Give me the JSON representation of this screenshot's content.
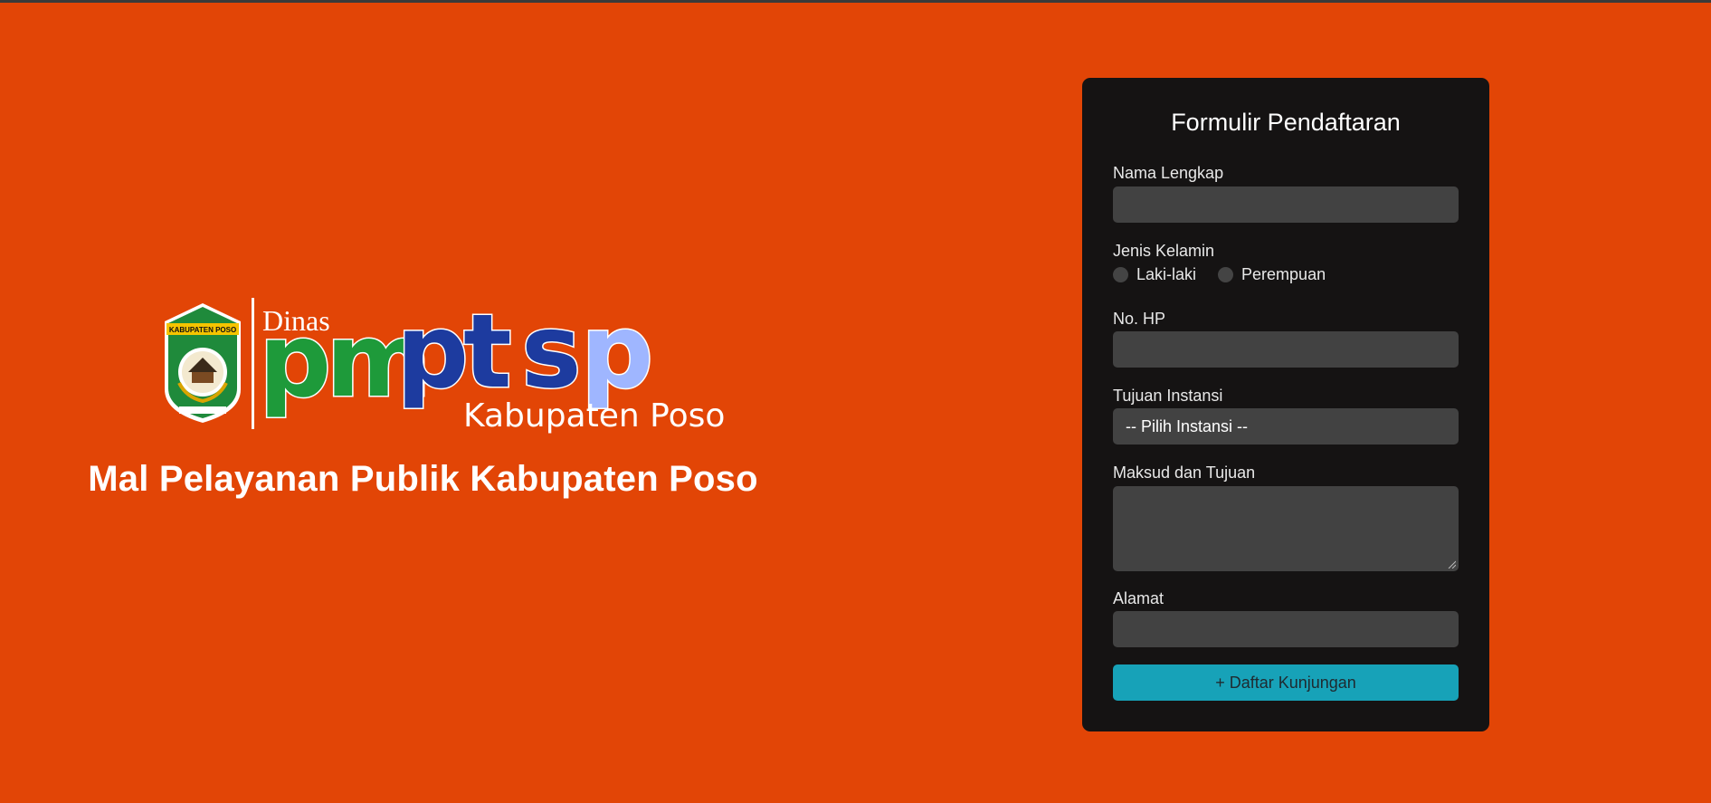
{
  "branding": {
    "logo_dinas": "Dinas",
    "logo_pm": "pm",
    "logo_ptsp_pt": "pt",
    "logo_ptsp_s": "s",
    "logo_ptsp_p": "p",
    "logo_region": "Kabupaten Poso",
    "emblem_banner": "KABUPATEN POSO",
    "hero_title": "Mal Pelayanan Publik Kabupaten Poso"
  },
  "form": {
    "title": "Formulir Pendaftaran",
    "name_label": "Nama Lengkap",
    "name_value": "",
    "gender_label": "Jenis Kelamin",
    "gender_options": [
      "Laki-laki",
      "Perempuan"
    ],
    "phone_label": "No. HP",
    "phone_value": "",
    "agency_label": "Tujuan Instansi",
    "agency_selected": "-- Pilih Instansi --",
    "purpose_label": "Maksud dan Tujuan",
    "purpose_value": "",
    "address_label": "Alamat",
    "address_value": "",
    "submit_label": "+ Daftar Kunjungan"
  },
  "colors": {
    "page_background": "#e24506",
    "card_background": "#151313",
    "field_background": "#424242",
    "button": "#17a2b8",
    "logo_green": "#1e9a3a",
    "logo_blue": "#1d3b9f",
    "logo_light_blue": "#9fb6ff"
  },
  "icons": {
    "emblem": "kabupaten-poso-emblem-icon",
    "resize": "resize-grip-icon"
  }
}
